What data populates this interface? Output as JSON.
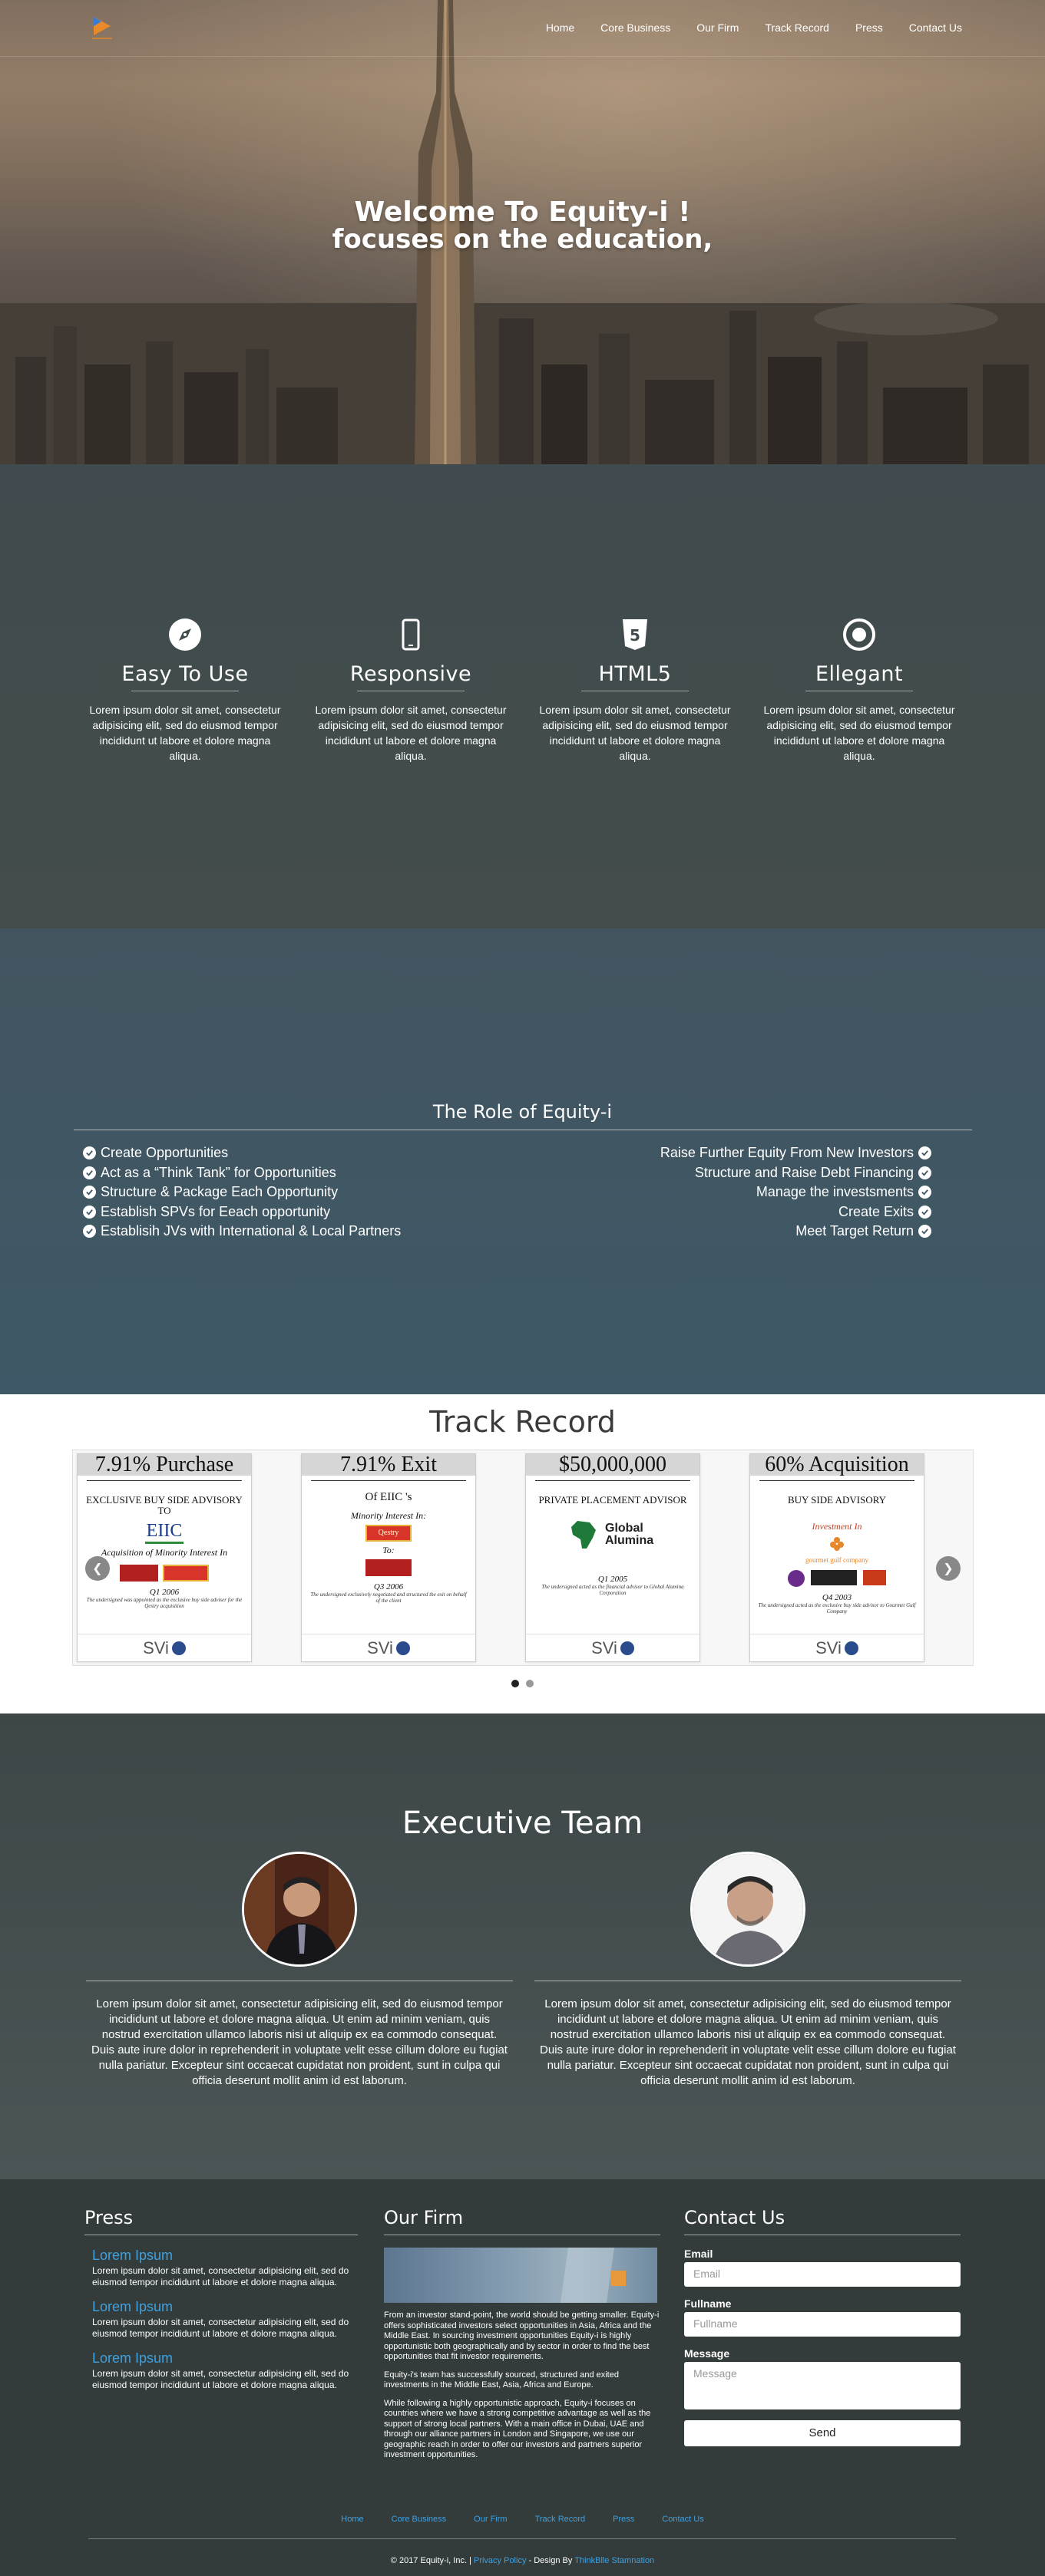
{
  "nav": {
    "items": [
      "Home",
      "Core Business",
      "Our Firm",
      "Track Record",
      "Press",
      "Contact Us"
    ]
  },
  "hero": {
    "line1": "Welcome To Equity-i !",
    "line2": "focuses on the education,"
  },
  "features": [
    {
      "icon": "compass-icon",
      "title": "Easy To Use",
      "text": "Lorem ipsum dolor sit amet, consectetur adipisicing elit, sed do eiusmod tempor incididunt ut labore et dolore magna aliqua."
    },
    {
      "icon": "mobile-icon",
      "title": "Responsive",
      "text": "Lorem ipsum dolor sit amet, consectetur adipisicing elit, sed do eiusmod tempor incididunt ut labore et dolore magna aliqua."
    },
    {
      "icon": "html5-icon",
      "title": "HTML5",
      "text": "Lorem ipsum dolor sit amet, consectetur adipisicing elit, sed do eiusmod tempor incididunt ut labore et dolore magna aliqua."
    },
    {
      "icon": "dot-circle-icon",
      "title": "Ellegant",
      "text": "Lorem ipsum dolor sit amet, consectetur adipisicing elit, sed do eiusmod tempor incididunt ut labore et dolore magna aliqua."
    }
  ],
  "role": {
    "title": "The Role of Equity-i",
    "left": [
      "Create Opportunities",
      "Act as a “Think Tank” for Opportunities",
      "Structure & Package Each Opportunity",
      "Establish SPVs for Eeach opportunity",
      "Establisih JVs with International & Local Partners"
    ],
    "right": [
      "Raise Further Equity From New Investors",
      "Structure and Raise Debt Financing",
      "Manage the investsments",
      "Create Exits",
      "Meet Target Return"
    ]
  },
  "track": {
    "title": "Track Record",
    "cards": [
      {
        "head": "7.91% Purchase",
        "sub": "EXCLUSIVE BUY SIDE ADVISORY TO",
        "brand": "EIIC",
        "ital": "Acquisition of Minority Interest In",
        "date": "Q1 2006",
        "small": "The undersigned was appointed as the exclusive buy side adviser for the Qestry acquisition",
        "foot": "SVi"
      },
      {
        "head": "7.91% Exit",
        "sub": "Of EIIC 's",
        "brand": "Qestry",
        "ital": "Minority Interest In:",
        "ital2": "To:",
        "date": "Q3 2006",
        "small": "The undersigned exclusively negotiated and structured the exit on behalf of the client",
        "foot": "SVi"
      },
      {
        "head": "$50,000,000",
        "sub": "PRIVATE PLACEMENT ADVISOR",
        "brand": "Global Alumina",
        "date": "Q1 2005",
        "small": "The undersigned acted as the financial advisor to Global Alumina Corporation",
        "foot": "SVi"
      },
      {
        "head": "60% Acquisition",
        "sub": "BUY SIDE ADVISORY",
        "brand": "gourmet gulf company",
        "ital": "Investment In",
        "date": "Q4 2003",
        "small": "The undersigned acted as the exclusive buy side advisor to Gourmet Gulf Company",
        "foot": "SVi"
      }
    ]
  },
  "team": {
    "title": "Executive Team",
    "members": [
      {
        "bio": "Lorem ipsum dolor sit amet, consectetur adipisicing elit, sed do eiusmod tempor incididunt ut labore et dolore magna aliqua. Ut enim ad minim veniam, quis nostrud exercitation ullamco laboris nisi ut aliquip ex ea commodo consequat. Duis aute irure dolor in reprehenderit in voluptate velit esse cillum dolore eu fugiat nulla pariatur. Excepteur sint occaecat cupidatat non proident, sunt in culpa qui officia deserunt mollit anim id est laborum."
      },
      {
        "bio": "Lorem ipsum dolor sit amet, consectetur adipisicing elit, sed do eiusmod tempor incididunt ut labore et dolore magna aliqua. Ut enim ad minim veniam, quis nostrud exercitation ullamco laboris nisi ut aliquip ex ea commodo consequat. Duis aute irure dolor in reprehenderit in voluptate velit esse cillum dolore eu fugiat nulla pariatur. Excepteur sint occaecat cupidatat non proident, sunt in culpa qui officia deserunt mollit anim id est laborum."
      }
    ]
  },
  "footer": {
    "press": {
      "title": "Press",
      "items": [
        {
          "title": "Lorem Ipsum",
          "text": "Lorem ipsum dolor sit amet, consectetur adipisicing elit, sed do eiusmod tempor incididunt ut labore et dolore magna aliqua."
        },
        {
          "title": "Lorem Ipsum",
          "text": "Lorem ipsum dolor sit amet, consectetur adipisicing elit, sed do eiusmod tempor incididunt ut labore et dolore magna aliqua."
        },
        {
          "title": "Lorem Ipsum",
          "text": "Lorem ipsum dolor sit amet, consectetur adipisicing elit, sed do eiusmod tempor incididunt ut labore et dolore magna aliqua."
        }
      ]
    },
    "firm": {
      "title": "Our Firm",
      "p1": "From an investor stand-point, the world should be getting smaller. Equity-i offers sophisticated investors select opportunities in Asia, Africa and the Middle East. In sourcing investment opportunities Equity-i is highly opportunistic both geographically and by sector in order to find the best opportunities that fit investor requirements.",
      "p2": "Equity-i's team has successfully sourced, structured and exited investments in the Middle East, Asia, Africa and Europe.",
      "p3": "While following a highly opportunistic approach, Equity-i focuses on countries where we have a strong competitive advantage as well as the support of strong local partners. With a main office in Dubai, UAE and through our alliance partners in London and Singapore, we use our geographic reach in order to offer our investors and partners superior investment opportunities."
    },
    "contact": {
      "title": "Contact Us",
      "email_label": "Email",
      "email_placeholder": "Email",
      "name_label": "Fullname",
      "name_placeholder": "Fullname",
      "message_label": "Message",
      "message_placeholder": "Message",
      "send": "Send"
    },
    "nav": [
      "Home",
      "Core Business",
      "Our Firm",
      "Track Record",
      "Press",
      "Contact Us"
    ],
    "copy_prefix": "© 2017 Equity-i, Inc. | ",
    "privacy": "Privacy Policy",
    "design_by": " - Design By ",
    "designer": "ThinkBlle Stamnation"
  },
  "colors": {
    "link": "#3ea1e0",
    "role_bg": "#42596a",
    "footer_bg": "#343b3b"
  }
}
